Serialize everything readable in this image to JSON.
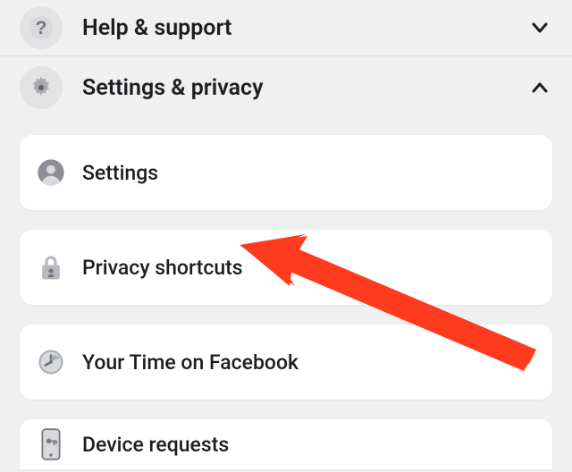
{
  "menu": {
    "help": {
      "label": "Help & support",
      "expanded": false
    },
    "settings": {
      "label": "Settings & privacy",
      "expanded": true
    }
  },
  "settings_items": [
    {
      "label": "Settings",
      "icon": "person-circle-icon"
    },
    {
      "label": "Privacy shortcuts",
      "icon": "lock-icon"
    },
    {
      "label": "Your Time on Facebook",
      "icon": "clock-icon"
    },
    {
      "label": "Device requests",
      "icon": "phone-key-icon"
    }
  ],
  "annotation": {
    "target": "Privacy shortcuts",
    "color": "#ff3b1f"
  }
}
